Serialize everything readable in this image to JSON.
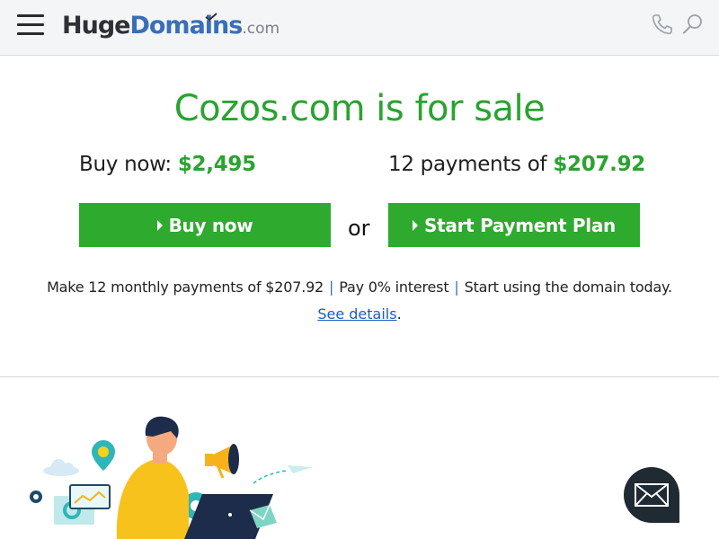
{
  "header": {
    "menu_icon": "hamburger-menu-icon",
    "logo": {
      "part1": "Huge",
      "part2": "Domains",
      "part3": ".com"
    },
    "phone_icon": "phone-icon",
    "search_icon": "search-icon"
  },
  "main": {
    "title": "Cozos.com is for sale",
    "buy_now_prefix": "Buy now: ",
    "buy_now_price": "$2,495",
    "payments_prefix": "12 payments of ",
    "payments_price": "$207.92",
    "buy_now_button": "Buy now",
    "or_text": "or",
    "payment_plan_button": "Start Payment Plan",
    "info_part1": "Make 12 monthly payments of $207.92",
    "info_sep": "|",
    "info_part2": "Pay 0% interest",
    "info_part3": "Start using the domain today.",
    "details_link": "See details",
    "details_suffix": "."
  },
  "chat": {
    "icon": "envelope-icon"
  },
  "colors": {
    "green": "#2aa331",
    "button_green": "#2eaa2e",
    "logo_blue": "#3a6fb7",
    "link_blue": "#1a5cc4",
    "header_bg": "#f4f5f7",
    "chat_bg": "#1f2a33"
  }
}
